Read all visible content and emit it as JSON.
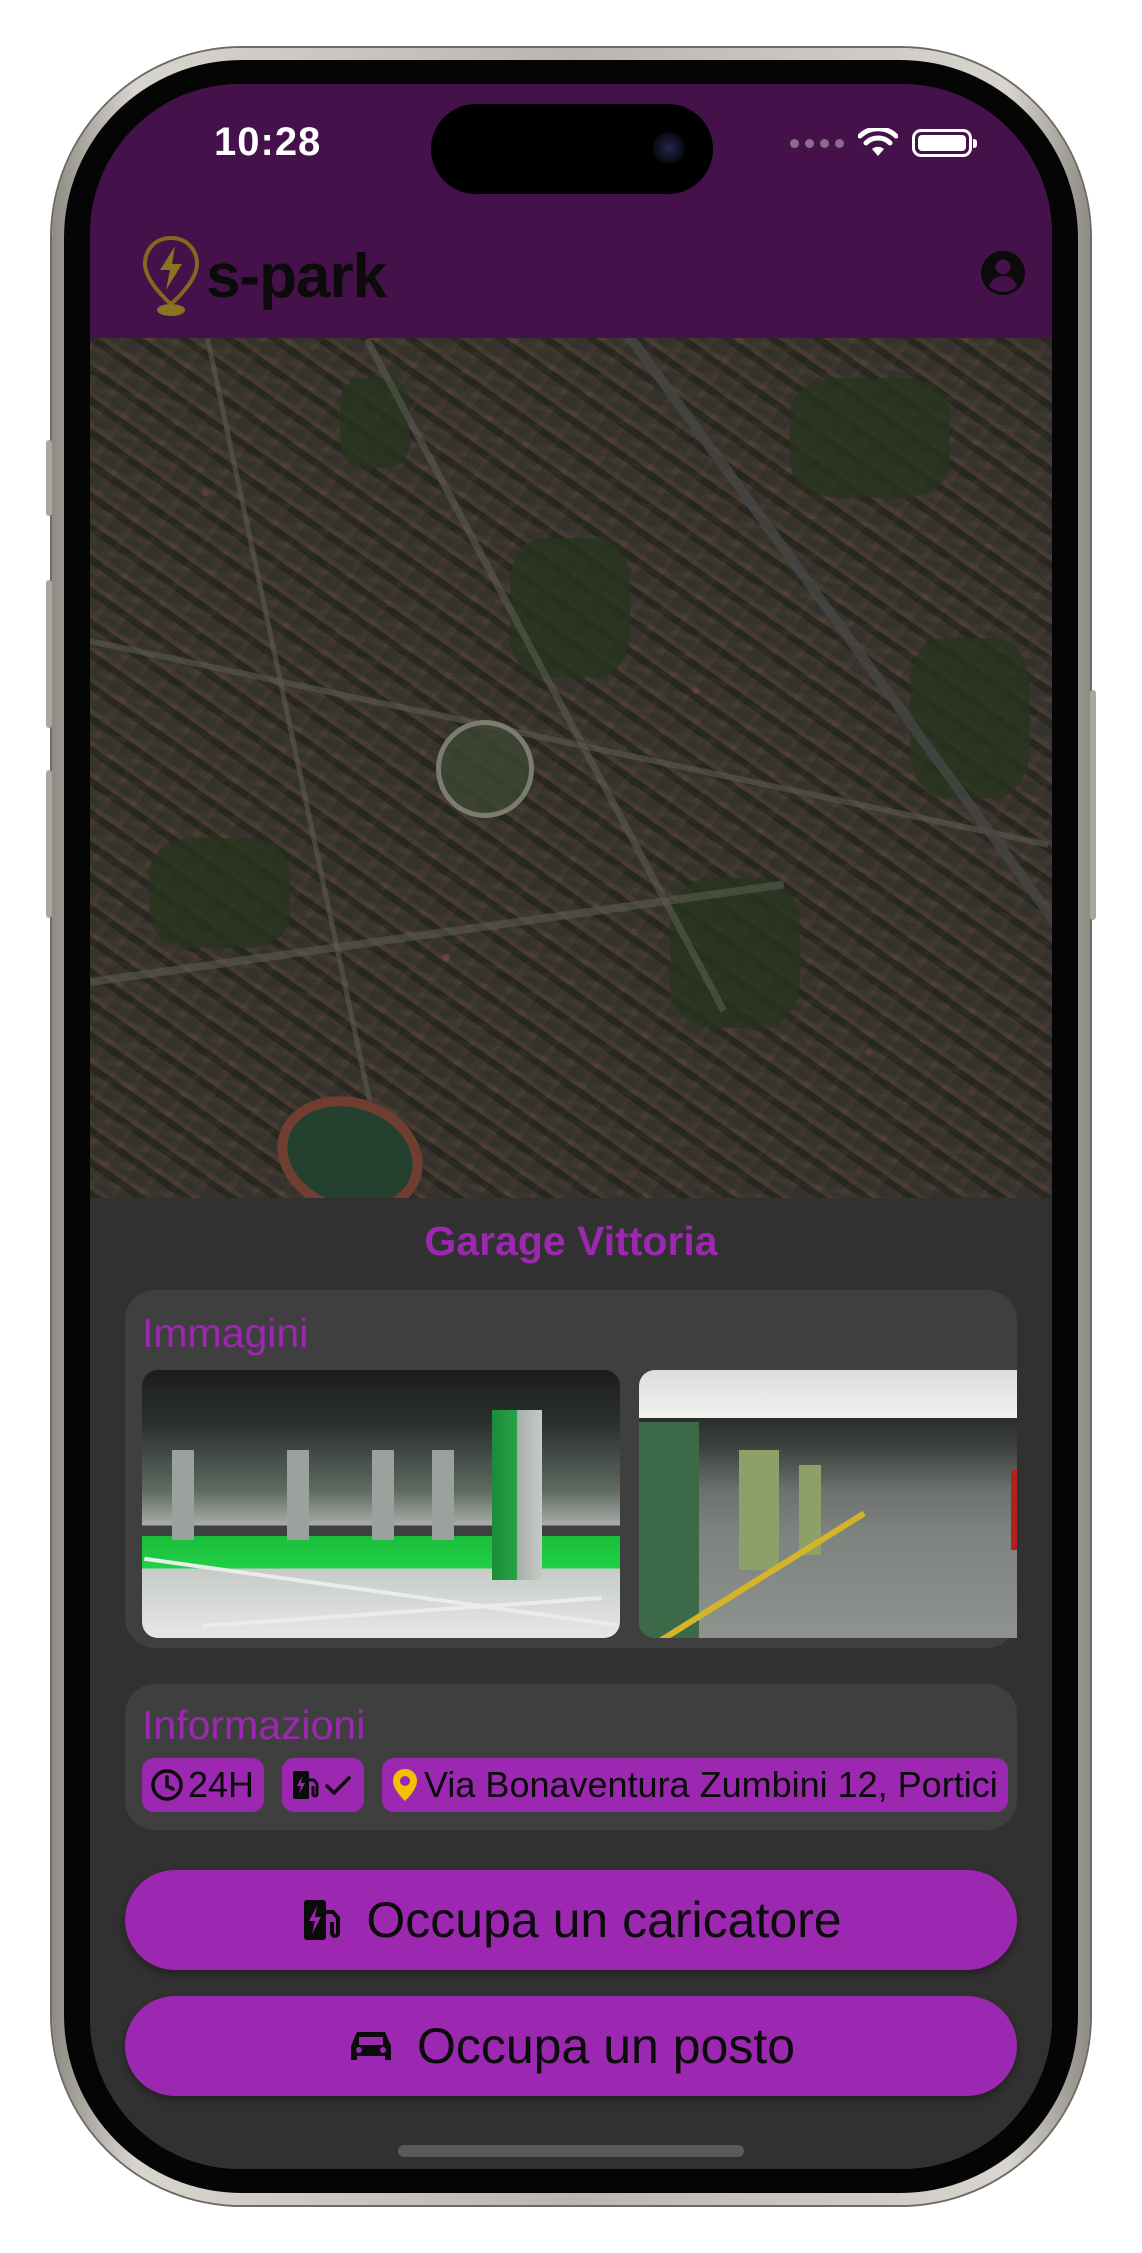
{
  "status_bar": {
    "time": "10:28",
    "signal_icon": "cellular-signal-icon",
    "wifi_icon": "wifi-icon",
    "battery_icon": "battery-icon"
  },
  "app_bar": {
    "logo_icon": "charging-location-pin-icon",
    "logo_text": "s-park",
    "account_icon": "account-circle-icon",
    "background_color": "#45114a"
  },
  "map": {
    "type": "satellite",
    "current_location_icon": "location-dot-icon"
  },
  "garage": {
    "name": "Garage Vittoria"
  },
  "images_section": {
    "title": "Immagini",
    "images": [
      {
        "name": "garage-image-1"
      },
      {
        "name": "garage-image-2"
      }
    ]
  },
  "info_section": {
    "title": "Informazioni",
    "hours": {
      "icon": "clock-icon",
      "label": "24H"
    },
    "charging": {
      "icon": "ev-station-icon",
      "check_icon": "check-icon"
    },
    "address": {
      "icon": "location-pin-icon",
      "label": "Via Bonaventura Zumbini 12, Portici"
    }
  },
  "actions": {
    "charger": {
      "icon": "ev-station-icon",
      "label": "Occupa un caricatore"
    },
    "spot": {
      "icon": "car-icon",
      "label": "Occupa un posto"
    }
  },
  "colors": {
    "accent": "#9c27b0",
    "sheet_background": "#313131",
    "card_background": "#3f3f3f"
  }
}
